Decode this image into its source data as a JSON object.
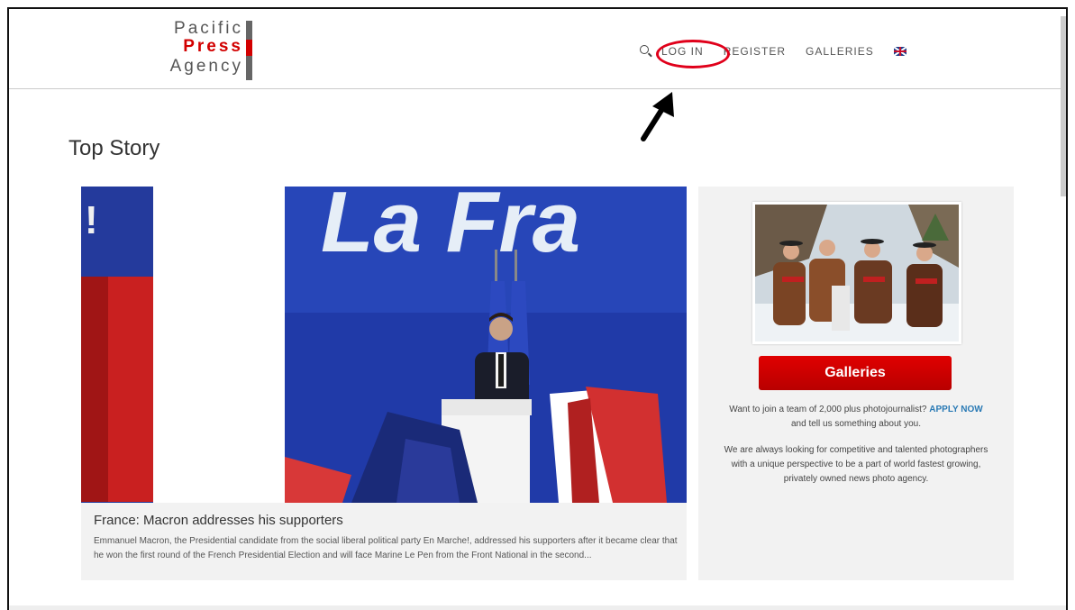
{
  "logo": {
    "line1": "Pacific",
    "line2": "Press",
    "line3": "Agency"
  },
  "nav": {
    "search_icon": "search-icon",
    "items": [
      "LOG IN",
      "REGISTER",
      "GALLERIES"
    ],
    "flag_icon": "uk-flag-icon"
  },
  "page": {
    "title": "Top Story"
  },
  "story": {
    "headline": "France: Macron addresses his supporters",
    "text": "Emmanuel Macron, the Presidential candidate from the social liberal political party En Marche!, addressed his supporters after it became clear that he won the first round of the French Presidential Election and will face Marine Le Pen from the Front National in the second..."
  },
  "sidebar": {
    "button": "Galleries",
    "p1_before": "Want to join a team of 2,000 plus photojournalist?",
    "p1_link": "APPLY NOW",
    "p1_after": "and tell us something about you.",
    "p2": "We are always looking for competitive and talented photographers with a unique perspective to be a part of world fastest growing, privately owned news photo agency."
  },
  "colors": {
    "accent": "#d20000",
    "link": "#2a7ab5",
    "annotation": "#e0001a"
  }
}
